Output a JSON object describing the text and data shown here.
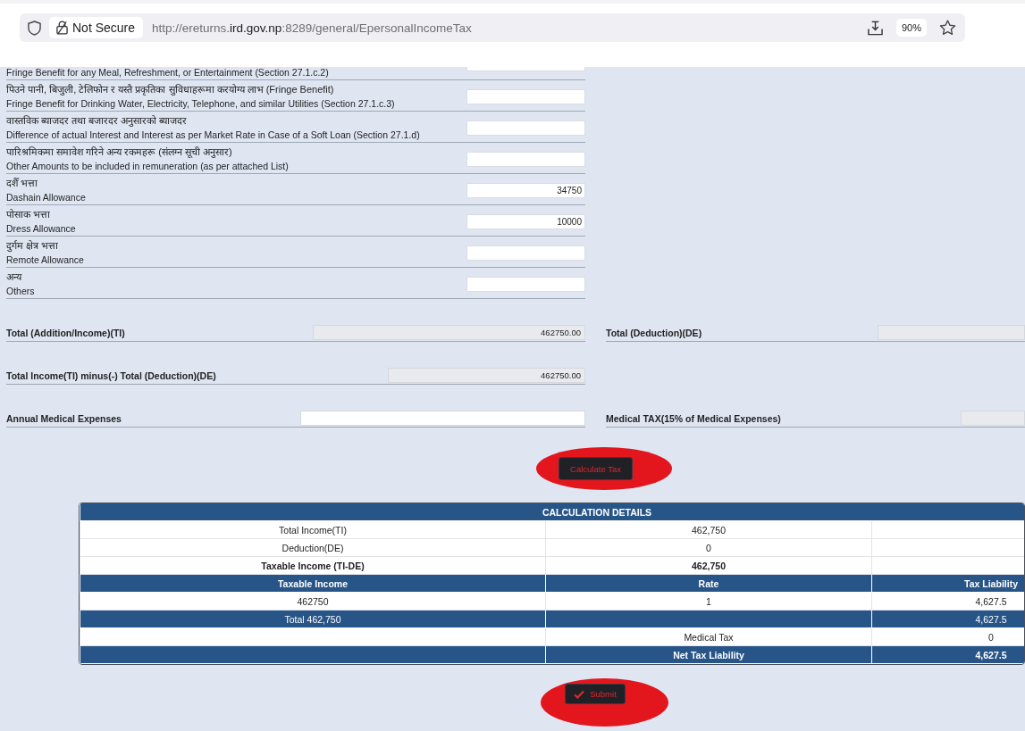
{
  "browser": {
    "security_label": "Not Secure",
    "url": {
      "prefix": "http://ereturns.",
      "domain": "ird.gov.np",
      "path": ":8289/general/EpersonalIncomeTax"
    },
    "zoom": "90%"
  },
  "income_rows": [
    {
      "label_en": "Fringe Benefit for any Meal, Refreshment, or Entertainment (Section 27.1.c.2)",
      "cut_off_at_top": true
    },
    {
      "label_np": "पिउने पानी, बिजुली, टेलिफोन र यस्तै प्रकृतिका सुविधाहरूमा करयोग्य लाभ (Fringe Benefit)",
      "label_en": "Fringe Benefit for Drinking Water, Electricity, Telephone, and similar Utilities (Section 27.1.c.3)",
      "cut_off_at_top": false
    },
    {
      "label_np": "वास्तविक ब्याजदर तथा बजारदर अनुसारको ब्याजदर",
      "label_en": "Difference of actual Interest and Interest as per Market Rate in Case of a Soft Loan (Section 27.1.d)",
      "cut_off_at_top": false
    },
    {
      "label_np": "पारिश्रमिकमा समावेश गरिने अन्य रकमहरू (संलग्न सूची अनुसार)",
      "label_en": "Other Amounts to be included in remuneration (as per attached List)",
      "cut_off_at_top": false
    },
    {
      "label_np": "दशैँ भत्ता",
      "label_en": "Dashain Allowance",
      "value": "34750",
      "cut_off_at_top": false
    },
    {
      "label_np": "पोसाक भत्ता",
      "label_en": "Dress Allowance",
      "value": "10000",
      "cut_off_at_top": false
    },
    {
      "label_np": "दुर्गम क्षेत्र भत्ता",
      "label_en": "Remote Allowance",
      "cut_off_at_top": false
    },
    {
      "label_np": "अन्य",
      "label_en": "Others",
      "cut_off_at_top": false
    }
  ],
  "totals": [
    {
      "left": {
        "label": "Total (Addition/Income)(TI)",
        "value": "462750.00",
        "readonly": true
      },
      "right": {
        "label": "Total (Deduction)(DE)",
        "readonly": true
      }
    },
    {
      "left": {
        "label": "Total Income(TI) minus(-) Total (Deduction)(DE)",
        "value": "462750.00",
        "readonly": true
      }
    },
    {
      "left": {
        "label": "Annual Medical Expenses",
        "readonly": false
      },
      "right": {
        "label": "Medical TAX(15% of Medical Expenses)",
        "readonly": true
      }
    }
  ],
  "calculate_button": {
    "label": "Calculate Tax",
    "highlighted": true
  },
  "calculation_details": {
    "title": "CALCULATION DETAILS",
    "summary_rows": [
      {
        "label": "Total Income(TI)",
        "value": "462,750",
        "bold": false
      },
      {
        "label": "Deduction(DE)",
        "value": "0",
        "bold": false
      },
      {
        "label": "Taxable Income (TI-DE)",
        "value": "462,750",
        "bold": true
      }
    ],
    "columns": [
      "Taxable Income",
      "Rate",
      "Tax Liability"
    ],
    "rows": [
      {
        "kind": "slab",
        "taxable_income": "462750",
        "rate": "1",
        "tax_liability": "4,627.5"
      },
      {
        "kind": "total",
        "label": "Total 462,750",
        "amount": "4,627.5"
      },
      {
        "kind": "medical",
        "label": "Medical Tax",
        "amount": "0"
      },
      {
        "kind": "net",
        "label": "Net Tax Liability",
        "amount": "4,627.5"
      }
    ]
  },
  "submit_button": {
    "label": "Submit",
    "highlighted": true
  }
}
